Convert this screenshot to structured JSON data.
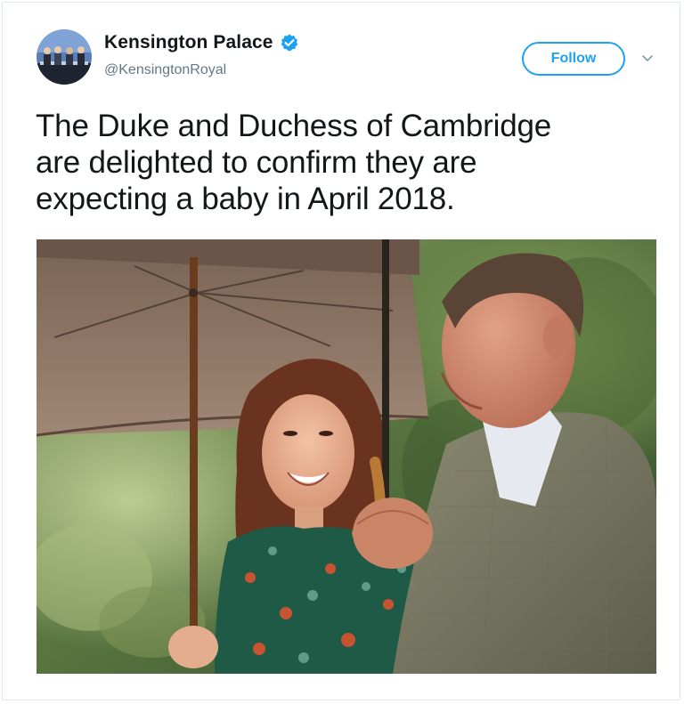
{
  "profile": {
    "display_name": "Kensington Palace",
    "handle": "@KensingtonRoyal",
    "verified": true,
    "avatar_icon": "profile-photo",
    "verified_icon": "verified-badge-icon"
  },
  "actions": {
    "follow_label": "Follow",
    "more_icon": "chevron-down-icon"
  },
  "tweet": {
    "lines": [
      "The Duke and Duchess of Cambridge",
      "are delighted to confirm they are",
      "expecting a baby in April 2018."
    ]
  },
  "colors": {
    "accent": "#1da1f2",
    "text": "#14171a",
    "secondary_text": "#657786",
    "border": "#e1e8ed"
  }
}
